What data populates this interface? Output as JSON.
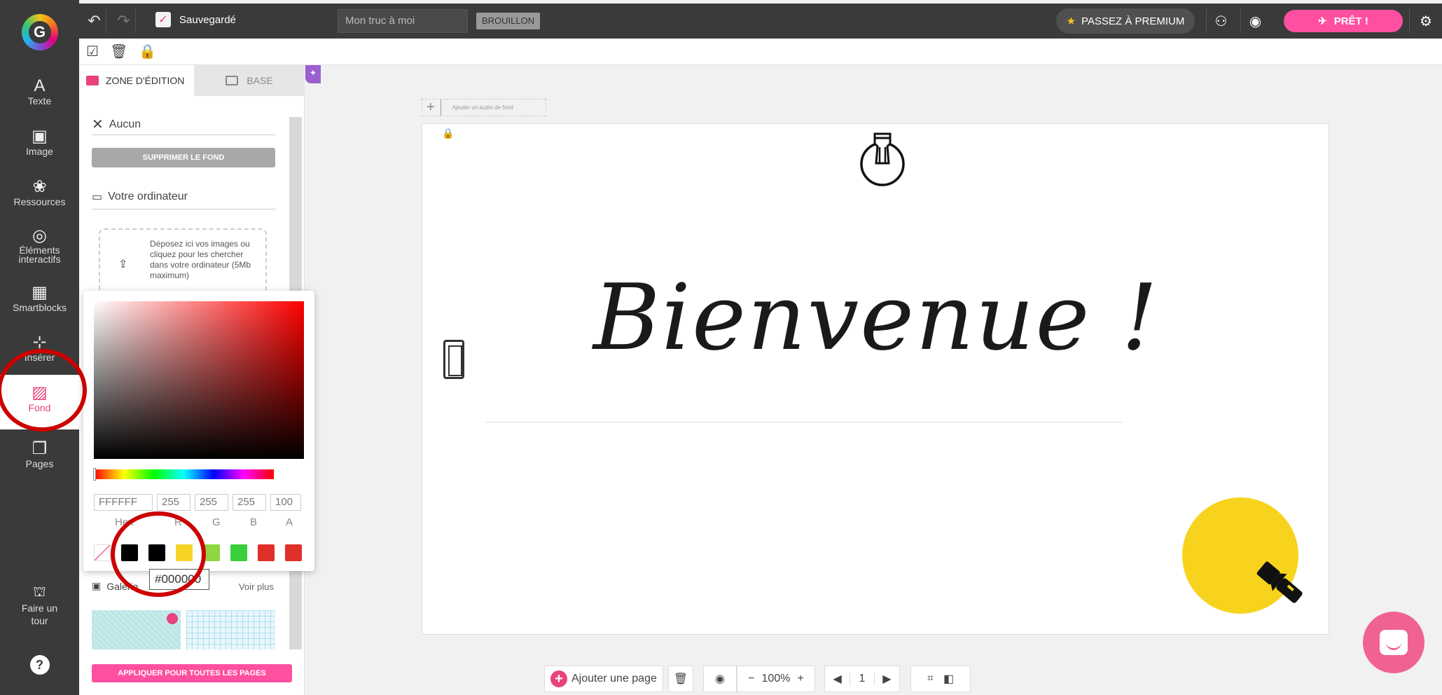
{
  "topbar": {
    "saved_label": "Sauvegardé",
    "title_value": "Mon truc à moi",
    "status_badge": "BROUILLON",
    "premium_label": "PASSEZ À PREMIUM",
    "ready_label": "PRÊT !"
  },
  "rail": {
    "items": [
      {
        "label": "Texte",
        "icon": "text-icon"
      },
      {
        "label": "Image",
        "icon": "image-icon"
      },
      {
        "label": "Ressources",
        "icon": "resources-icon"
      },
      {
        "label": "Éléments interactifs",
        "icon": "interactive-icon"
      },
      {
        "label": "Smartblocks",
        "icon": "smartblocks-icon"
      },
      {
        "label": "Insérer",
        "icon": "insert-icon"
      },
      {
        "label": "Fond",
        "icon": "background-icon"
      },
      {
        "label": "Pages",
        "icon": "pages-icon"
      }
    ],
    "tour_label": "Faire un tour",
    "help_label": "?"
  },
  "panel": {
    "tab_edit": "ZONE D'ÉDITION",
    "tab_base": "BASE",
    "none_label": "Aucun",
    "remove_bg_button": "SUPPRIMER LE FOND",
    "computer_label": "Votre ordinateur",
    "drop_text": "Déposez ici vos images ou cliquez pour les chercher dans votre ordinateur (5Mb maximum)",
    "gallery_label": "Galerie",
    "see_more": "Voir plus",
    "apply_all_button": "APPLIQUER POUR TOUTES LES PAGES"
  },
  "picker": {
    "hex": "FFFFFF",
    "r": "255",
    "g": "255",
    "b": "255",
    "a": "100",
    "label_hex": "Hex",
    "label_r": "R",
    "label_g": "G",
    "label_b": "B",
    "label_a": "A",
    "swatches": [
      "#000000",
      "#000000",
      "#f5d327",
      "#8fd641",
      "#3ccf3c",
      "#e0302a",
      "#e0302a"
    ],
    "tooltip": "#000000"
  },
  "canvas": {
    "audio_placeholder": "Ajouter un audio de fond",
    "welcome_text": "Bienvenue !"
  },
  "bottombar": {
    "add_page": "Ajouter une page",
    "zoom": "100%",
    "page_number": "1"
  },
  "colors": {
    "accent": "#ff4fa0",
    "dark": "#3a3a3a",
    "sun": "#f7d31e",
    "annotation": "#cc0000"
  }
}
